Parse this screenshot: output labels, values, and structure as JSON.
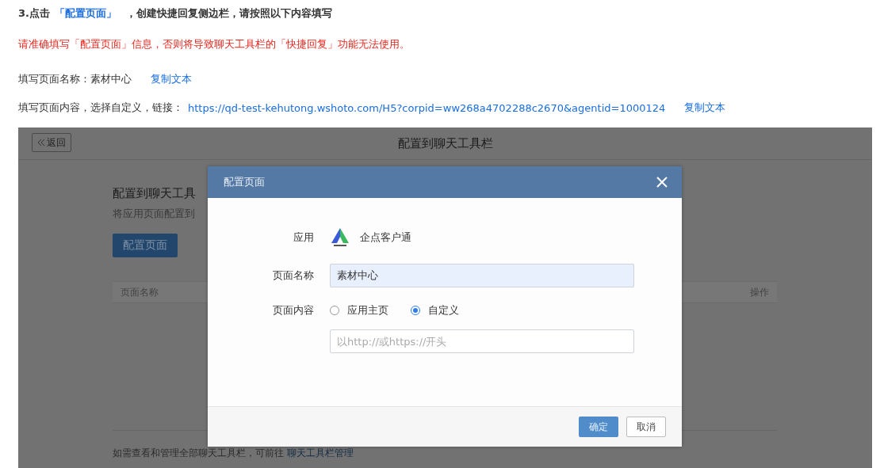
{
  "instructions": {
    "step_prefix": "3.点击",
    "step_link": "「配置页面」",
    "step_suffix": "，创建快捷回复侧边栏，请按照以下内容填写",
    "warning": "请准确填写「配置页面」信息，否则将导致聊天工具栏的「快捷回复」功能无法使用。",
    "name_line": {
      "label": "填写页面名称：",
      "value": "素材中心",
      "copy": "复制文本"
    },
    "content_line": {
      "label": "填写页面内容，选择自定义，链接：",
      "link": "https://qd-test-kehutong.wshoto.com/H5?corpid=ww268a4702288c2670&agentid=1000124",
      "copy": "复制文本"
    }
  },
  "screenshot": {
    "back_button": "返回",
    "title": "配置到聊天工具栏",
    "heading": "配置到聊天工具",
    "subtitle": "将应用页面配置到",
    "config_button": "配置页面",
    "table": {
      "columns": [
        "页面名称",
        "操作"
      ]
    },
    "footer_text": "如需查看和管理全部聊天工具栏，可前往",
    "footer_link": "聊天工具栏管理",
    "dialog": {
      "title": "配置页面",
      "app_label": "应用",
      "app_name": "企点客户通",
      "name_label": "页面名称",
      "name_value": "素材中心",
      "content_label": "页面内容",
      "options": [
        {
          "label": "应用主页",
          "selected": false
        },
        {
          "label": "自定义",
          "selected": true
        }
      ],
      "url_placeholder": "以http://或https://开头",
      "ok": "确定",
      "cancel": "取消"
    }
  }
}
